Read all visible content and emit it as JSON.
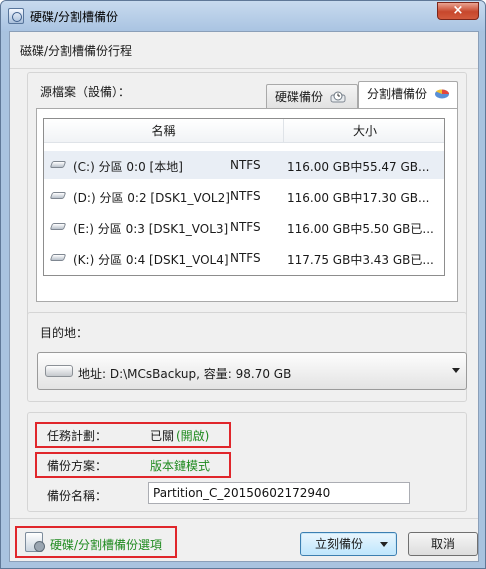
{
  "window": {
    "title": "硬碟/分割槽備份",
    "close_glyph": "×"
  },
  "heading": "磁碟/分割槽備份行程",
  "source": {
    "label": "源檔案（設備）：",
    "tabs": [
      {
        "label": "硬碟備份",
        "icon": "disk-clock-icon"
      },
      {
        "label": "分割槽備份",
        "icon": "pie-chart-icon",
        "active": true
      }
    ],
    "columns": [
      "名稱",
      "大小"
    ],
    "rows": [
      {
        "name": "(C:) 分區 0:0 [本地]",
        "fs": "NTFS",
        "size": "116.00 GB中55.47 GB...",
        "selected": true
      },
      {
        "name": "(D:) 分區 0:2 [DSK1_VOL2]",
        "fs": "NTFS",
        "size": "116.00 GB中17.30 GB..."
      },
      {
        "name": "(E:) 分區 0:3 [DSK1_VOL3]",
        "fs": "NTFS",
        "size": "116.00 GB中5.50 GB已..."
      },
      {
        "name": "(K:) 分區 0:4 [DSK1_VOL4]",
        "fs": "NTFS",
        "size": "117.75 GB中3.43 GB已..."
      }
    ]
  },
  "destination": {
    "label": "目的地：",
    "value": "地址: D:\\MCsBackup, 容量: 98.70 GB"
  },
  "plan": {
    "task_label": "任務計劃：",
    "task_value": "已關",
    "task_link": "(開啟)",
    "mode_label": "備份方案：",
    "mode_value": "版本鏈模式",
    "name_label": "備份名稱：",
    "name_value": "Partition_C_20150602172940"
  },
  "footer": {
    "options_link": "硬碟/分割槽備份選項",
    "backup_button": "立刻備份",
    "cancel_button": "取消"
  },
  "colors": {
    "link_green": "#1f8a1f",
    "highlight_red": "#e0262b"
  }
}
